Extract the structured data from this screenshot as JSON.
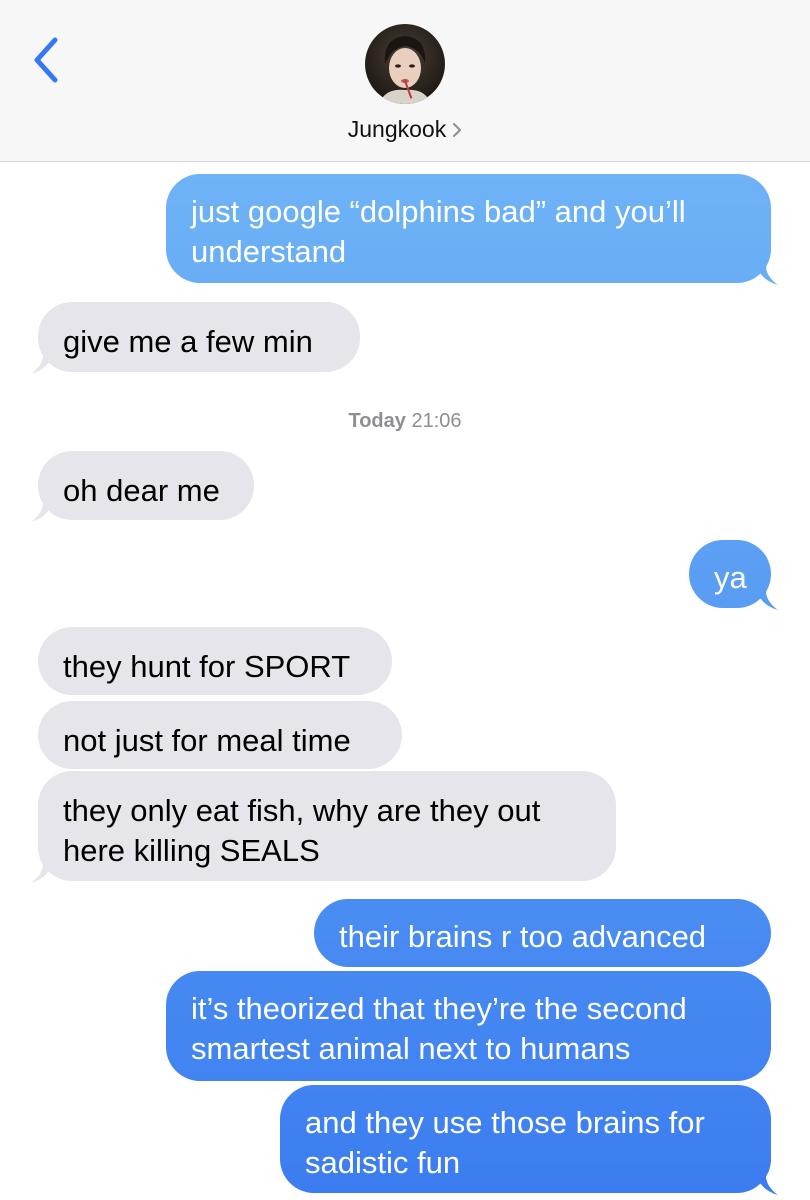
{
  "header": {
    "contact_name": "Jungkook",
    "contact_chevron": "›",
    "back_icon": "chevron-left-icon",
    "avatar_icon": "contact-photo"
  },
  "timestamp": {
    "day": "Today",
    "time": "21:06"
  },
  "colors": {
    "accent": "#3478f6",
    "incoming_bubble": "#e6e5eb",
    "outgoing_gradient_top": "#6fb4f6",
    "outgoing_gradient_bottom": "#3b7df0",
    "timestamp": "#8e8e93"
  },
  "messages": [
    {
      "direction": "outgoing",
      "lines": [
        "just google “dolphins bad” and you’ll",
        "understand"
      ]
    },
    {
      "direction": "incoming",
      "lines": [
        "give me a few min"
      ]
    },
    {
      "direction": "incoming",
      "lines": [
        "oh dear me"
      ]
    },
    {
      "direction": "outgoing",
      "lines": [
        "ya"
      ]
    },
    {
      "direction": "incoming",
      "lines": [
        "they hunt for SPORT"
      ]
    },
    {
      "direction": "incoming",
      "lines": [
        "not just for meal time"
      ]
    },
    {
      "direction": "incoming",
      "lines": [
        "they only eat fish, why are they out",
        "here killing SEALS"
      ]
    },
    {
      "direction": "outgoing",
      "lines": [
        "their brains r too advanced"
      ]
    },
    {
      "direction": "outgoing",
      "lines": [
        "it’s theorized that they’re the second",
        "smartest animal next to humans"
      ]
    },
    {
      "direction": "outgoing",
      "lines": [
        "and they use those brains for",
        "sadistic fun"
      ]
    }
  ]
}
